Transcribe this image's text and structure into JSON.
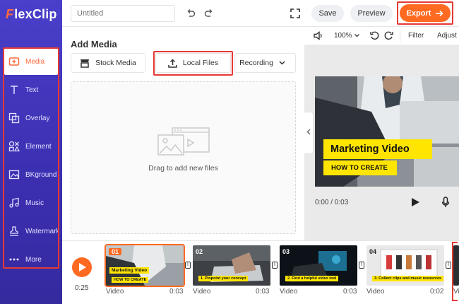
{
  "app": {
    "logo_text": "lexClip",
    "logo_letter": "F"
  },
  "sidebar": {
    "items": [
      {
        "label": "Media",
        "icon": "media-icon",
        "active": true
      },
      {
        "label": "Text",
        "icon": "text-icon"
      },
      {
        "label": "Overlay",
        "icon": "overlay-icon"
      },
      {
        "label": "Element",
        "icon": "element-icon"
      },
      {
        "label": "BKground",
        "icon": "background-icon"
      },
      {
        "label": "Music",
        "icon": "music-icon"
      },
      {
        "label": "Watermark",
        "icon": "watermark-icon"
      },
      {
        "label": "More",
        "icon": "more-icon"
      }
    ]
  },
  "toolbar": {
    "title_placeholder": "Untitled",
    "save_label": "Save",
    "preview_label": "Preview",
    "export_label": "Export"
  },
  "media_panel": {
    "title": "Add Media",
    "tabs": {
      "stock": "Stock Media",
      "local": "Local Files",
      "recording": "Recording"
    },
    "drop_text": "Drag to add new files"
  },
  "preview": {
    "zoom": "100%",
    "filter_label": "Filter",
    "adjust_label": "Adjust",
    "video_title": "Marketing Video",
    "video_subtitle": "HOW TO CREATE",
    "time": "0:00 / 0:03"
  },
  "timeline": {
    "total_duration": "0:25",
    "clips": [
      {
        "num": "01",
        "label": "Video",
        "duration": "0:03",
        "title": "Marketing Video",
        "caption": "HOW TO CREATE"
      },
      {
        "num": "02",
        "label": "Video",
        "duration": "0:03",
        "caption": "1. Pinpoint your concept"
      },
      {
        "num": "03",
        "label": "Video",
        "duration": "0:03",
        "caption": "2. Find a helpful video tool"
      },
      {
        "num": "04",
        "label": "Video",
        "duration": "0:02",
        "caption": "3. Collect clips and music resources"
      },
      {
        "label": "Video"
      }
    ]
  },
  "colors": {
    "accent": "#ff6a22",
    "sidebar": "#3f34bb",
    "highlight": "#e53935",
    "yellow": "#ffe500"
  }
}
